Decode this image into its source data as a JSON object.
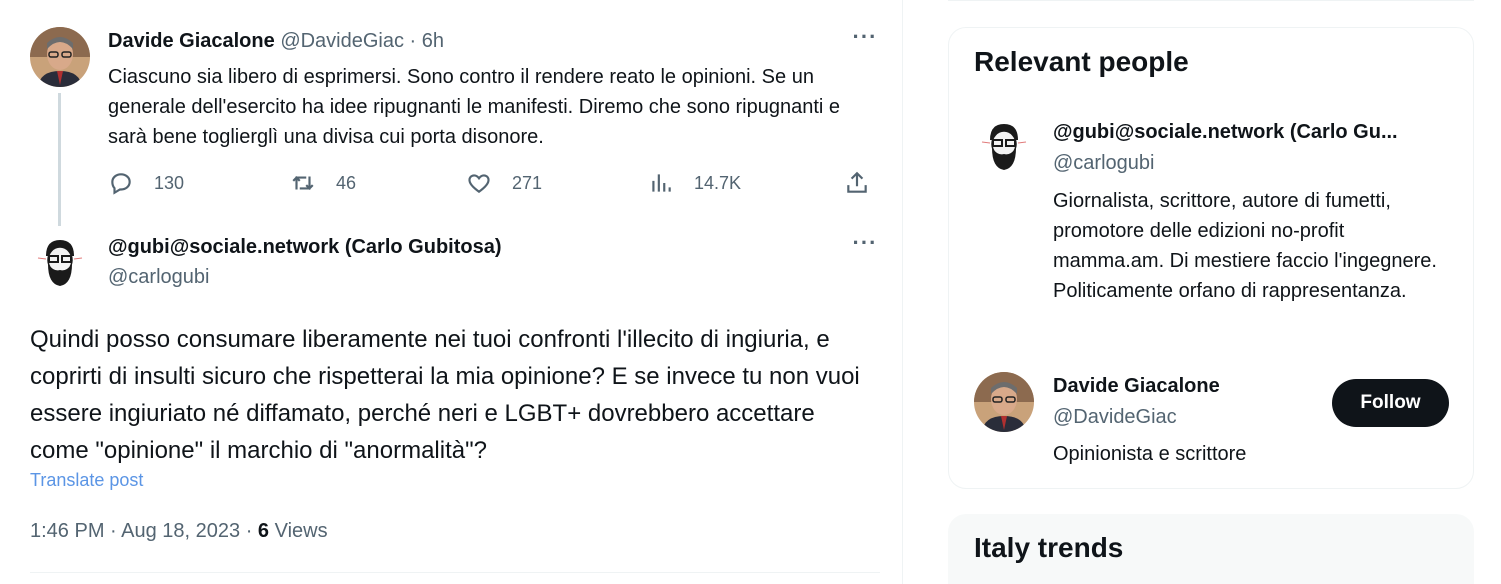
{
  "parent_tweet": {
    "name": "Davide Giacalone",
    "handle": "@DavideGiac",
    "separator": " · ",
    "time": "6h",
    "text": "Ciascuno sia libero di esprimersi. Sono contro il rendere reato le opinioni. Se un generale dell'esercito ha idee ripugnanti le manifesti. Diremo che sono ripugnanti e sarà bene toglierglì una divisa cui porta disonore.",
    "more_icon": "···",
    "replies": "130",
    "retweets": "46",
    "likes": "271",
    "views": "14.7K"
  },
  "main_tweet": {
    "name": "@gubi@sociale.network (Carlo Gubitosa)",
    "handle": "@carlogubi",
    "more_icon": "···",
    "text": "Quindi posso consumare liberamente nei tuoi confronti l'illecito di ingiuria, e coprirti di insulti sicuro che rispetterai la mia opinione? E se invece tu non vuoi essere ingiuriato né diffamato, perché neri e LGBT+ dovrebbero accettare come \"opinione\" il marchio di \"anormalità\"?",
    "translate": "Translate post",
    "timestamp": "1:46 PM · Aug 18, 2023 · ",
    "views_count": "6",
    "views_label": " Views"
  },
  "sidebar": {
    "relevant_title": "Relevant people",
    "people": [
      {
        "name": "@gubi@sociale.network (Carlo Gu...",
        "handle": "@carlogubi",
        "bio": "Giornalista, scrittore, autore di fumetti, promotore delle edizioni no-profit mamma.am. Di mestiere faccio l'ingegnere. Politicamente orfano di rappresentanza."
      },
      {
        "name": "Davide Giacalone",
        "handle": "@DavideGiac",
        "bio": "Opinionista e scrittore",
        "follow_label": "Follow"
      }
    ],
    "trends_title": "Italy trends"
  },
  "icons": {
    "reply": "reply-icon",
    "retweet": "retweet-icon",
    "like": "heart-icon",
    "views": "views-icon",
    "share": "share-icon"
  },
  "colors": {
    "text": "#0f1419",
    "secondary": "#536471",
    "link": "#5b95e5",
    "button": "#0f1419"
  }
}
